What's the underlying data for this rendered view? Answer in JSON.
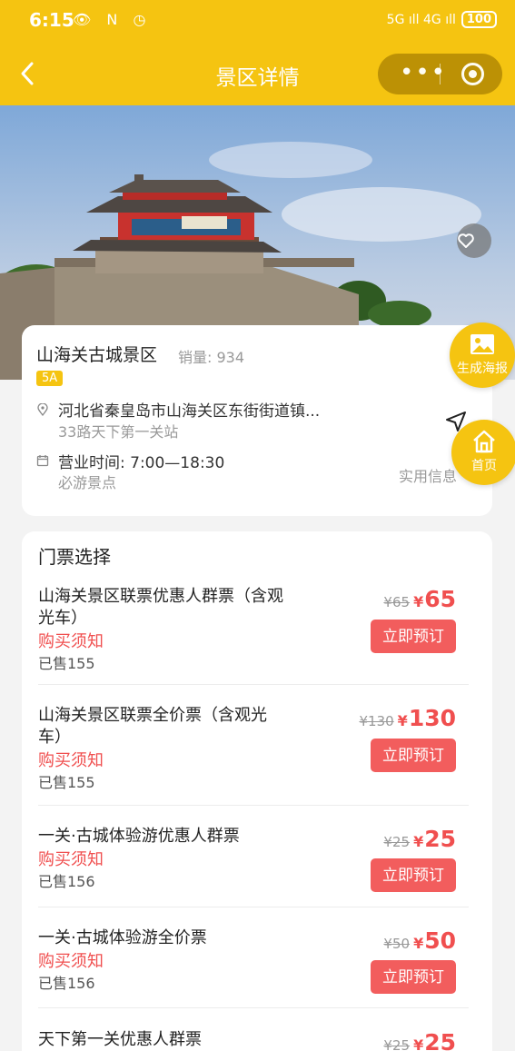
{
  "status_bar": {
    "time": "6:15",
    "left_icons": "👁 N ◷",
    "signal": "5G ıll 4G ıll",
    "battery": "100"
  },
  "header": {
    "back_icon": "chevron-left-icon",
    "title": "景区详情",
    "menu_dots": "•••",
    "colors": {
      "accent": "#f5c411"
    }
  },
  "scenic": {
    "name": "山海关古城景区",
    "sales": "销量: 934",
    "level": "5A",
    "address": "河北省秦皇岛市山海关区东街街道镇...",
    "bus_stop": "33路天下第一关站",
    "hours": "营业时间: 7:00—18:30",
    "tag": "必游景点",
    "practical_info": "实用信息"
  },
  "floating": {
    "poster": "生成海报",
    "home": "首页"
  },
  "tickets": {
    "title": "门票选择",
    "book_label": "立即预订",
    "notice_label": "购买须知",
    "items": [
      {
        "name": "山海关景区联票优惠人群票（含观光车）",
        "old_price": "¥65",
        "price": "65",
        "sold": "已售155"
      },
      {
        "name": "山海关景区联票全价票（含观光车）",
        "old_price": "¥130",
        "price": "130",
        "sold": "已售155"
      },
      {
        "name": "一关·古城体验游优惠人群票",
        "old_price": "¥25",
        "price": "25",
        "sold": "已售156"
      },
      {
        "name": "一关·古城体验游全价票",
        "old_price": "¥50",
        "price": "50",
        "sold": "已售156"
      },
      {
        "name": "天下第一关优惠人群票",
        "old_price": "¥25",
        "price": "25",
        "sold": ""
      }
    ]
  }
}
